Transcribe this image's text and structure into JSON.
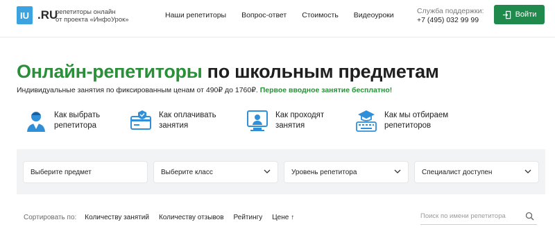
{
  "header": {
    "logo_mark": "IU",
    "logo_domain": ".RU",
    "logo_line1": "репетиторы онлайн",
    "logo_line2": "от проекта «ИнфоУрок»",
    "nav": [
      {
        "label": "Наши репетиторы"
      },
      {
        "label": "Вопрос-ответ"
      },
      {
        "label": "Стоимость"
      },
      {
        "label": "Видеоуроки"
      }
    ],
    "support_label": "Служба поддержки:",
    "support_phone": "+7 (495) 032 99 99",
    "login_label": "Войти",
    "login_icon": "login-door-icon"
  },
  "hero": {
    "title_green": "Онлайн-репетиторы",
    "title_rest": " по школьным предметам",
    "subtitle": "Индивидуальные занятия по фиксированным ценам от 490₽ до 1760₽.",
    "promo": "Первое вводное занятие бесплатно!"
  },
  "info_links": [
    {
      "label": "Как выбрать репетитора",
      "icon": "tutor-person-icon"
    },
    {
      "label": "Как оплачивать занятия",
      "icon": "payment-card-icon"
    },
    {
      "label": "Как проходят занятия",
      "icon": "video-lesson-icon"
    },
    {
      "label": "Как мы отбираем репетиторов",
      "icon": "graduation-keyboard-icon"
    }
  ],
  "filters": [
    {
      "label": "Выберите предмет"
    },
    {
      "label": "Выберите класс"
    },
    {
      "label": "Уровень репетитора"
    },
    {
      "label": "Специалист доступен"
    }
  ],
  "sort": {
    "label": "Сортировать по:",
    "options": [
      "Количеству занятий",
      "Количеству отзывов",
      "Рейтингу",
      "Цене ↑"
    ]
  },
  "search": {
    "placeholder": "Поиск по имени репетитора"
  },
  "colors": {
    "brand_green": "#2a8f39",
    "button_green": "#1f8a4c",
    "logo_blue": "#3ba4e0",
    "icon_blue": "#2f8fd8"
  }
}
